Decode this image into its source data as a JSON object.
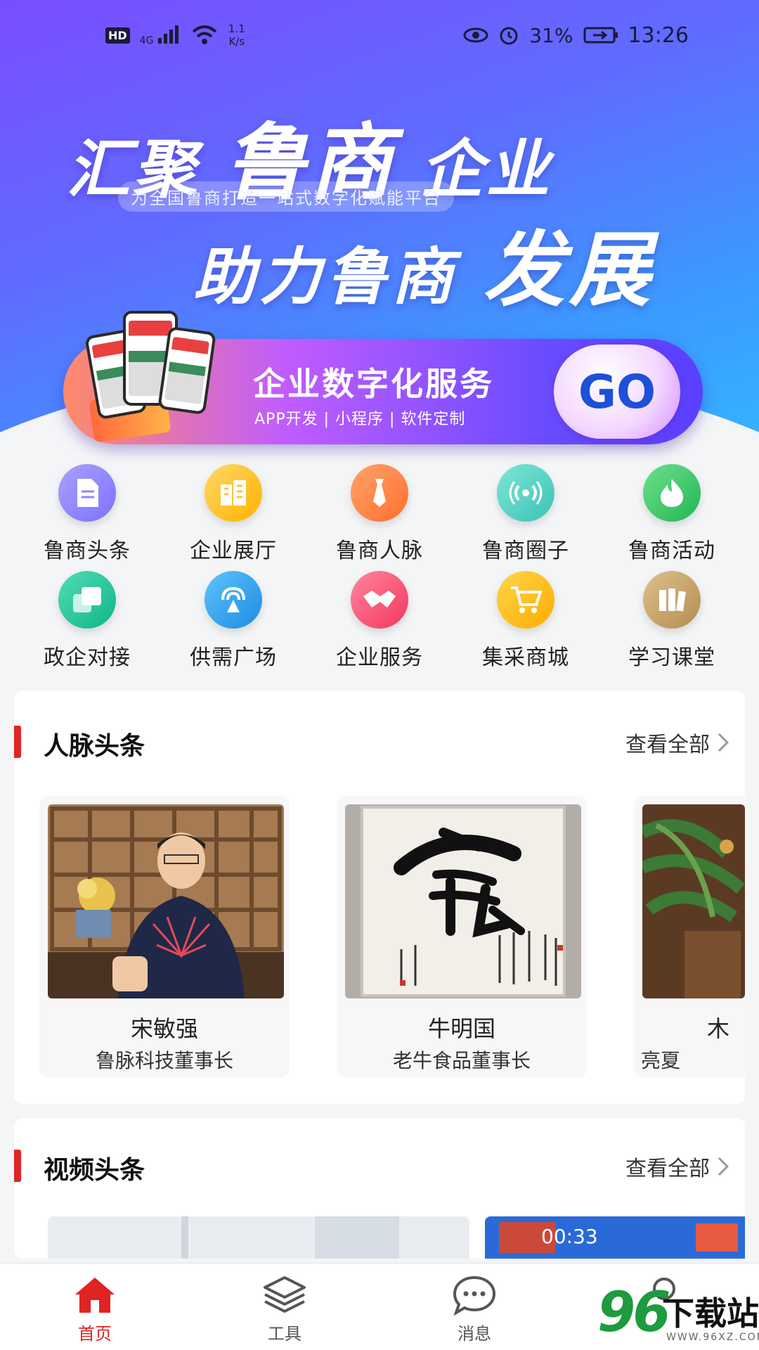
{
  "status_bar": {
    "hd": "HD",
    "network": "4G",
    "speed_value": "1.1",
    "speed_unit": "K/s",
    "battery": "31%",
    "time": "13:26"
  },
  "hero": {
    "title_line1_a": "汇聚",
    "title_line1_b": "鲁商",
    "title_line1_c": "企业",
    "subtitle": "为全国鲁商打造一站式数字化赋能平台",
    "title_line2_a": "助力鲁商",
    "title_line2_b": "发展"
  },
  "promo": {
    "title": "企业数字化服务",
    "tags": "APP开发 | 小程序 | 软件定制",
    "go": "GO"
  },
  "grid": {
    "items": [
      {
        "label": "鲁商头条",
        "color": "#8f86ff"
      },
      {
        "label": "企业展厅",
        "color": "#ffc533"
      },
      {
        "label": "鲁商人脉",
        "color": "#ff8a4c"
      },
      {
        "label": "鲁商圈子",
        "color": "#5bd6c7"
      },
      {
        "label": "鲁商活动",
        "color": "#3ecb6a"
      },
      {
        "label": "政企对接",
        "color": "#25c8a0"
      },
      {
        "label": "供需广场",
        "color": "#2fa3f0"
      },
      {
        "label": "企业服务",
        "color": "#ff5f7e"
      },
      {
        "label": "集采商城",
        "color": "#ffc11f"
      },
      {
        "label": "学习课堂",
        "color": "#c9a56a"
      }
    ]
  },
  "people_section": {
    "title": "人脉头条",
    "more": "查看全部",
    "people": [
      {
        "name": "宋敏强",
        "title": "鲁脉科技董事长"
      },
      {
        "name": "牛明国",
        "title": "老牛食品董事长"
      },
      {
        "name": "木",
        "title": "亮夏"
      }
    ]
  },
  "video_section": {
    "title": "视频头条",
    "more": "查看全部",
    "thumb_time": "00:33"
  },
  "bottom_nav": {
    "items": [
      {
        "label": "首页"
      },
      {
        "label": "工具"
      },
      {
        "label": "消息"
      }
    ]
  },
  "watermark": {
    "num": "96",
    "text": "下载站",
    "url": "WWW.96XZ.COM"
  }
}
